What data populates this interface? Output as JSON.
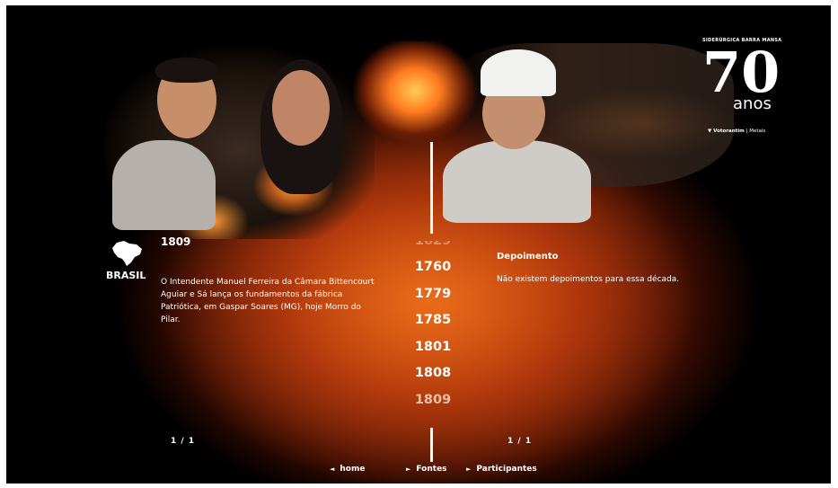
{
  "logo": {
    "company": "SIDERÚRGICA BARRA MANSA",
    "number": "70",
    "suffix": "anos",
    "brand": "Votorantim",
    "division": "Metais"
  },
  "left_panel": {
    "country": "BRASIL",
    "year": "1809",
    "text": "O Intendente Manuel Ferreira da Câmara Bittencourt Aguiar e Sá lança os fundamentos da fábrica Patriótica, em Gaspar Soares (MG), hoje Morro do Pilar.",
    "pagination": "1  /  1"
  },
  "timeline": {
    "partial_year": "1629",
    "years": [
      "1760",
      "1779",
      "1785",
      "1801",
      "1808"
    ],
    "current_year": "1809"
  },
  "right_panel": {
    "title": "Depoimento",
    "text": "Não existem depoimentos para essa década.",
    "pagination": "1  /  1"
  },
  "nav": {
    "home": "home",
    "fontes": "Fontes",
    "participantes": "Participantes"
  },
  "colors": {
    "background": "#000000",
    "glow": "#c9420e",
    "text": "#ffffff"
  }
}
